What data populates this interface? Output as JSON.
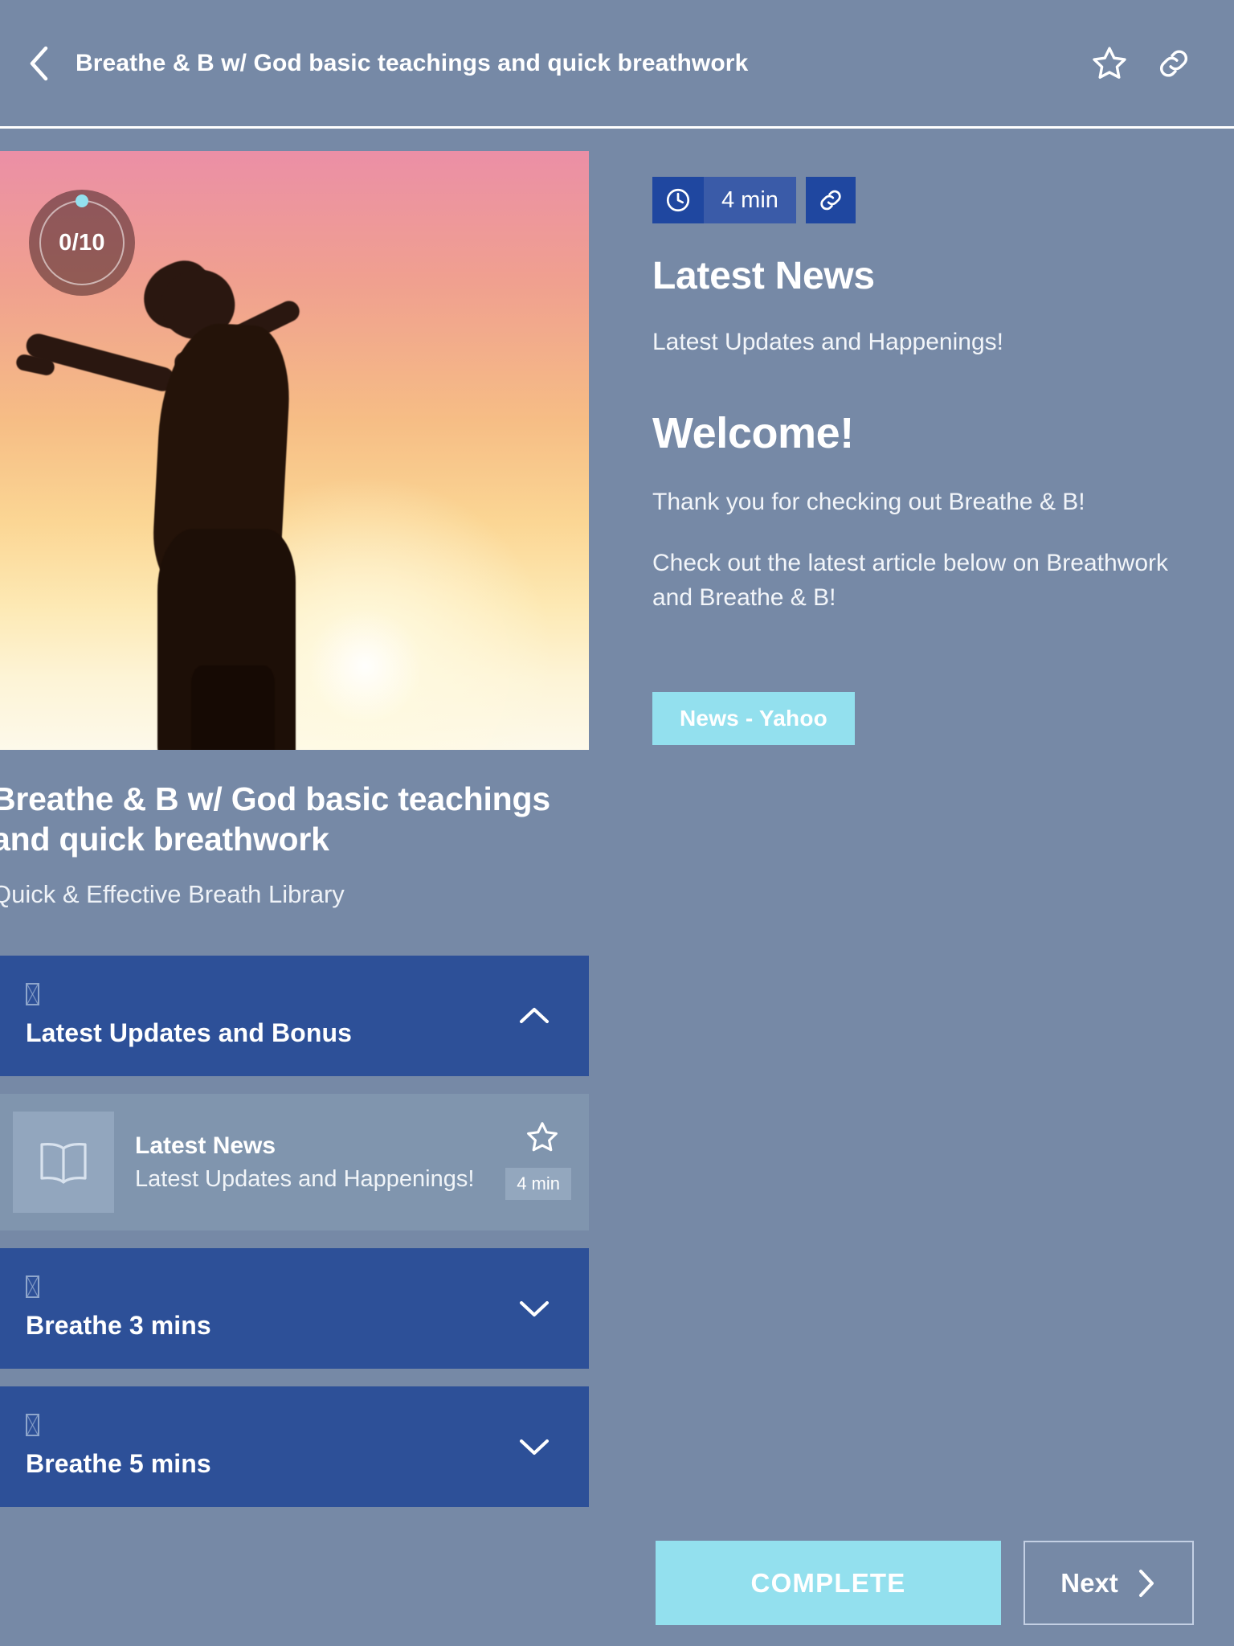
{
  "appbar": {
    "title": "Breathe & B w/ God basic teachings and quick breathwork",
    "back_icon": "chevron-left-icon",
    "favorite_icon": "star-outline-icon",
    "share_icon": "link-icon"
  },
  "course": {
    "progress_label": "0/10",
    "progress_completed": 0,
    "progress_total": 10,
    "title": "Breathe & B w/ God basic teachings and quick breathwork",
    "subtitle": "Quick & Effective Breath Library"
  },
  "sections": [
    {
      "title": "Latest Updates and Bonus",
      "expanded": true,
      "chevron": "chevron-up-icon",
      "lessons": [
        {
          "title": "Latest News",
          "description": "Latest Updates and Happenings!",
          "duration": "4 min",
          "icon": "book-icon",
          "favorite_icon": "star-outline-icon"
        }
      ]
    },
    {
      "title": "Breathe 3 mins",
      "expanded": false,
      "chevron": "chevron-down-icon",
      "lessons": []
    },
    {
      "title": "Breathe 5 mins",
      "expanded": false,
      "chevron": "chevron-down-icon",
      "lessons": []
    }
  ],
  "content": {
    "duration": "4 min",
    "clock_icon": "clock-icon",
    "link_icon": "link-icon",
    "heading": "Latest News",
    "subheading": "Latest Updates and Happenings!",
    "welcome_heading": "Welcome!",
    "paragraph_1": "Thank you for checking out Breathe & B!",
    "paragraph_2": "Check out the latest article below on Breathwork and Breathe & B!",
    "news_button": "News - Yahoo"
  },
  "footer": {
    "complete_label": "COMPLETE",
    "next_label": "Next",
    "next_icon": "chevron-right-icon"
  },
  "colors": {
    "background": "#7689a6",
    "section_blue": "#2d5098",
    "accent_cyan": "#93e0ee",
    "pill_dark": "#1f47a0",
    "pill_light": "#3a5ba8"
  }
}
